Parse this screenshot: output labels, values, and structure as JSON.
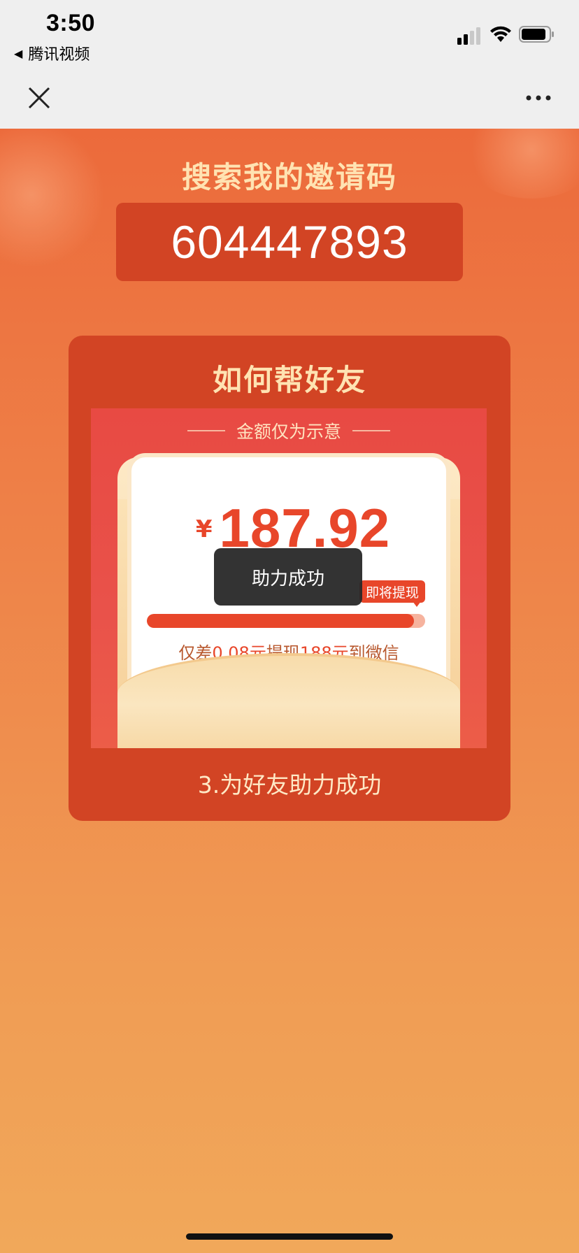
{
  "status_bar": {
    "time": "3:50",
    "back_app_label": "腾讯视频",
    "icons": [
      "signal-icon",
      "wifi-icon",
      "battery-icon"
    ]
  },
  "nav": {
    "close_icon": "close-icon",
    "more_icon": "more-icon"
  },
  "invite": {
    "title": "搜索我的邀请码",
    "code": "604447893"
  },
  "help_card": {
    "title": "如何帮好友",
    "demo": {
      "note": "金额仅为示意",
      "currency": "¥",
      "amount": "187.92",
      "toast": "助力成功",
      "badge": "即将提现",
      "progress_percent": 96,
      "progress_text_prefix": "仅差",
      "progress_text_highlight": "0.08元",
      "progress_text_middle": "提现",
      "progress_text_highlight2": "188元",
      "progress_text_suffix": "到微信"
    },
    "step_caption": "3.为好友助力成功"
  },
  "colors": {
    "accent_red": "#e8462a",
    "card_bg": "#d24424",
    "title_gold": "#ffe3b2"
  }
}
